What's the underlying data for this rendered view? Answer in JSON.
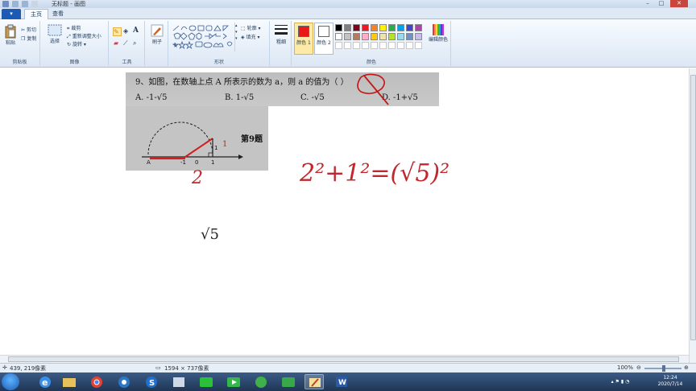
{
  "window": {
    "title": "无标题 - 画图"
  },
  "tabs": {
    "file": "",
    "home": "主页",
    "view": "查看"
  },
  "ribbon": {
    "clipboard": {
      "paste": "粘贴",
      "cut": "剪切",
      "copy": "复制",
      "label": "剪贴板"
    },
    "image": {
      "select": "选择",
      "crop": "裁剪",
      "resize": "重新调整大小",
      "rotate": "旋转",
      "label": "图像"
    },
    "tools": {
      "label": "工具"
    },
    "brushes": {
      "label": "刷子"
    },
    "shapes": {
      "outline": "轮廓",
      "fill": "填充",
      "label": "形状"
    },
    "size": {
      "label": "粗细"
    },
    "colors": {
      "color1_label": "颜色 1",
      "color2_label": "颜色 2",
      "edit_label": "编辑颜色",
      "label": "颜色",
      "color1": "#e81a1a",
      "color2": "#ffffff",
      "palette_row1": [
        "#000000",
        "#7f7f7f",
        "#880015",
        "#ed1c24",
        "#ff7f27",
        "#fff200",
        "#22b14c",
        "#00a2e8",
        "#3f48cc",
        "#a349a4"
      ],
      "palette_row2": [
        "#ffffff",
        "#c3c3c3",
        "#b97a57",
        "#ffaec9",
        "#ffc90e",
        "#efe4b0",
        "#b5e61d",
        "#99d9ea",
        "#7092be",
        "#c8bfe7"
      ],
      "palette_row3": [
        "#ffffff",
        "#ffffff",
        "#ffffff",
        "#ffffff",
        "#ffffff",
        "#ffffff",
        "#ffffff",
        "#ffffff",
        "#ffffff",
        "#ffffff"
      ]
    }
  },
  "question": {
    "text": "9、如图，在数轴上点 A 所表示的数为 a，则 a 的值为（    ）",
    "option_a": "A. -1-√5",
    "option_b": "B. 1-√5",
    "option_c": "C. -√5",
    "option_d": "D. -1+√5",
    "figure_caption": "第9题",
    "tick_neg1": "-1",
    "tick_0": "0",
    "tick_1": "1",
    "side_label": "1",
    "point_a": "A"
  },
  "annotations": {
    "red_one": "1",
    "red_two": "2",
    "equation": "2²+1²=(√5)²",
    "root_five": "√5"
  },
  "status": {
    "cursor_pos": "439, 219像素",
    "image_size": "1594 × 737像素",
    "zoom": "100%"
  },
  "taskbar": {
    "time": "12:24",
    "date": "2020/7/14"
  }
}
